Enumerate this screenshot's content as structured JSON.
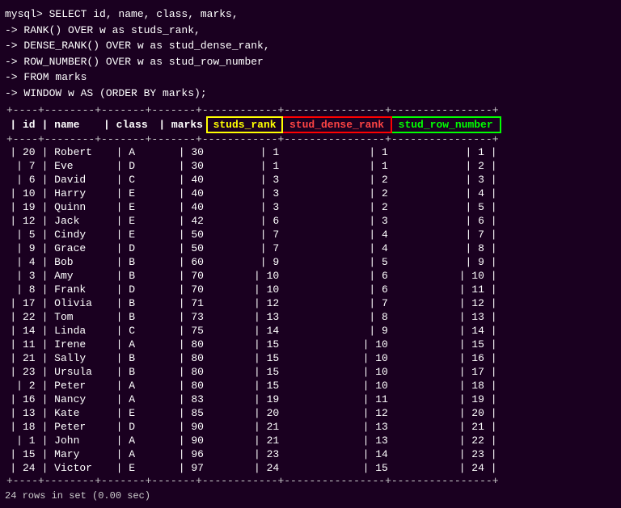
{
  "terminal": {
    "prompt_lines": [
      "mysql> SELECT id, name, class, marks,",
      "    -> RANK() OVER w as studs_rank,",
      "    -> DENSE_RANK() OVER w as stud_dense_rank,",
      "    -> ROW_NUMBER() OVER w as stud_row_number",
      "    -> FROM marks",
      "    -> WINDOW w AS (ORDER BY marks);"
    ],
    "columns": [
      "id",
      "name",
      "class",
      "marks",
      "studs_rank",
      "stud_dense_rank",
      "stud_row_number"
    ],
    "rows": [
      [
        20,
        "Robert",
        "A",
        30,
        1,
        1,
        1
      ],
      [
        7,
        "Eve",
        "D",
        30,
        1,
        1,
        2
      ],
      [
        6,
        "David",
        "C",
        40,
        3,
        2,
        3
      ],
      [
        10,
        "Harry",
        "E",
        40,
        3,
        2,
        4
      ],
      [
        19,
        "Quinn",
        "E",
        40,
        3,
        2,
        5
      ],
      [
        12,
        "Jack",
        "E",
        42,
        6,
        3,
        6
      ],
      [
        5,
        "Cindy",
        "E",
        50,
        7,
        4,
        7
      ],
      [
        9,
        "Grace",
        "D",
        50,
        7,
        4,
        8
      ],
      [
        4,
        "Bob",
        "B",
        60,
        9,
        5,
        9
      ],
      [
        3,
        "Amy",
        "B",
        70,
        10,
        6,
        10
      ],
      [
        8,
        "Frank",
        "D",
        70,
        10,
        6,
        11
      ],
      [
        17,
        "Olivia",
        "B",
        71,
        12,
        7,
        12
      ],
      [
        22,
        "Tom",
        "B",
        73,
        13,
        8,
        13
      ],
      [
        14,
        "Linda",
        "C",
        75,
        14,
        9,
        14
      ],
      [
        11,
        "Irene",
        "A",
        80,
        15,
        10,
        15
      ],
      [
        21,
        "Sally",
        "B",
        80,
        15,
        10,
        16
      ],
      [
        23,
        "Ursula",
        "B",
        80,
        15,
        10,
        17
      ],
      [
        2,
        "Peter",
        "A",
        80,
        15,
        10,
        18
      ],
      [
        16,
        "Nancy",
        "A",
        83,
        19,
        11,
        19
      ],
      [
        13,
        "Kate",
        "E",
        85,
        20,
        12,
        20
      ],
      [
        18,
        "Peter",
        "D",
        90,
        21,
        13,
        21
      ],
      [
        1,
        "John",
        "A",
        90,
        21,
        13,
        22
      ],
      [
        15,
        "Mary",
        "A",
        96,
        23,
        14,
        23
      ],
      [
        24,
        "Victor",
        "E",
        97,
        24,
        15,
        24
      ]
    ],
    "footer": "24 rows in set (0.00 sec)"
  }
}
